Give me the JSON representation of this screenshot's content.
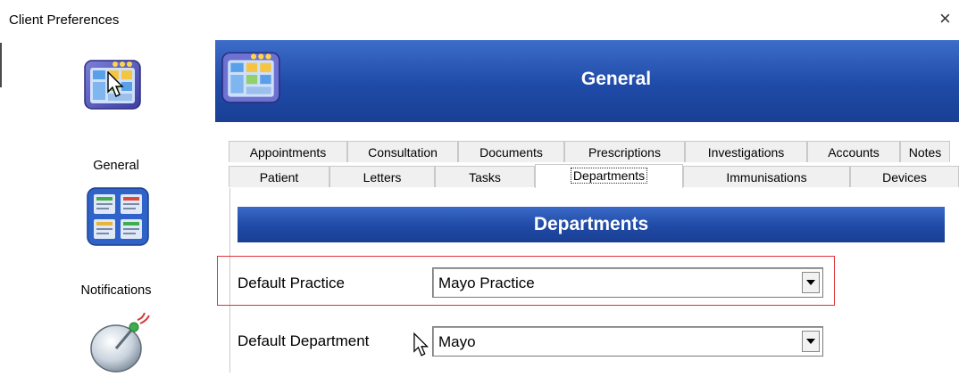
{
  "window": {
    "title": "Client Preferences",
    "close_glyph": "×"
  },
  "sidebar": {
    "items": [
      {
        "label": "",
        "icon": "general-settings-icon"
      },
      {
        "label": "General",
        "icon": "general-forms-icon"
      },
      {
        "label": "Notifications",
        "icon": "satellite-dish-icon"
      }
    ]
  },
  "header": {
    "title": "General",
    "icon": "general-settings-icon",
    "accent": "#1f4ba8"
  },
  "tabs": {
    "row1": [
      "Appointments",
      "Consultation",
      "Documents",
      "Prescriptions",
      "Investigations",
      "Accounts",
      "Notes"
    ],
    "row2": [
      "Patient",
      "Letters",
      "Tasks",
      "Departments",
      "Immunisations",
      "Devices"
    ],
    "active": "Departments"
  },
  "section": {
    "title": "Departments"
  },
  "form": {
    "default_practice": {
      "label": "Default Practice",
      "value": "Mayo Practice"
    },
    "default_department": {
      "label": "Default Department",
      "value": "Mayo"
    }
  },
  "highlight_color": "#e0323a"
}
